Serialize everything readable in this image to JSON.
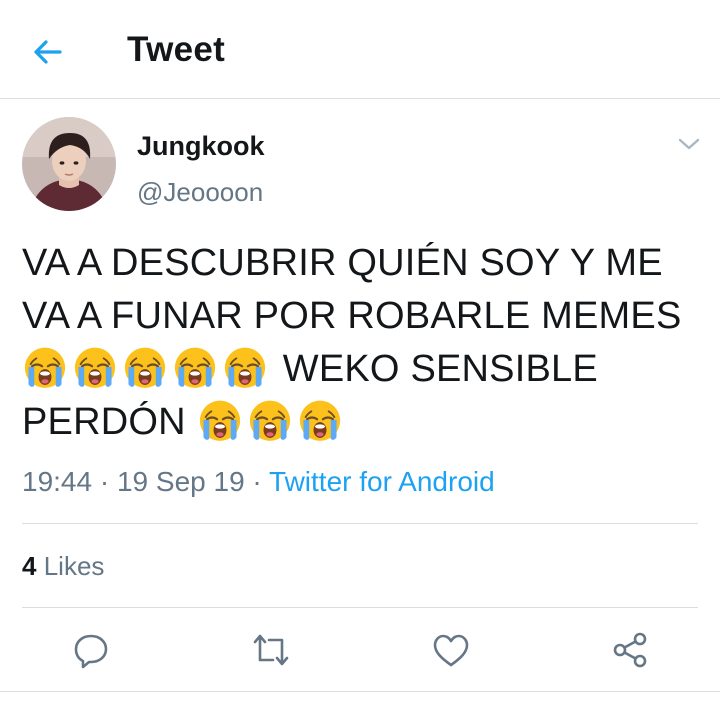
{
  "header": {
    "title": "Tweet"
  },
  "tweet": {
    "author_name": "Jungkook",
    "author_handle": "@Jeoooon",
    "text": {
      "line1": "VA A DESCUBRIR QUIÉN SOY Y ME",
      "line2": "VA A FUNAR POR ROBARLE MEMES",
      "line3_after_emojis": "WEKO SENSIBLE",
      "line4": "PERDÓN"
    },
    "emoji_icon": "loudly-crying-face-icon",
    "meta": {
      "time": "19:44",
      "separator": "·",
      "date": "19 Sep 19",
      "source": "Twitter for Android"
    },
    "likes": {
      "count": "4",
      "label": "Likes"
    }
  },
  "actions": {
    "icons": [
      "reply-icon",
      "retweet-icon",
      "like-icon",
      "share-icon"
    ]
  },
  "colors": {
    "accent": "#1da1f2",
    "secondary_text": "#657786",
    "divider": "#d8dee2"
  }
}
